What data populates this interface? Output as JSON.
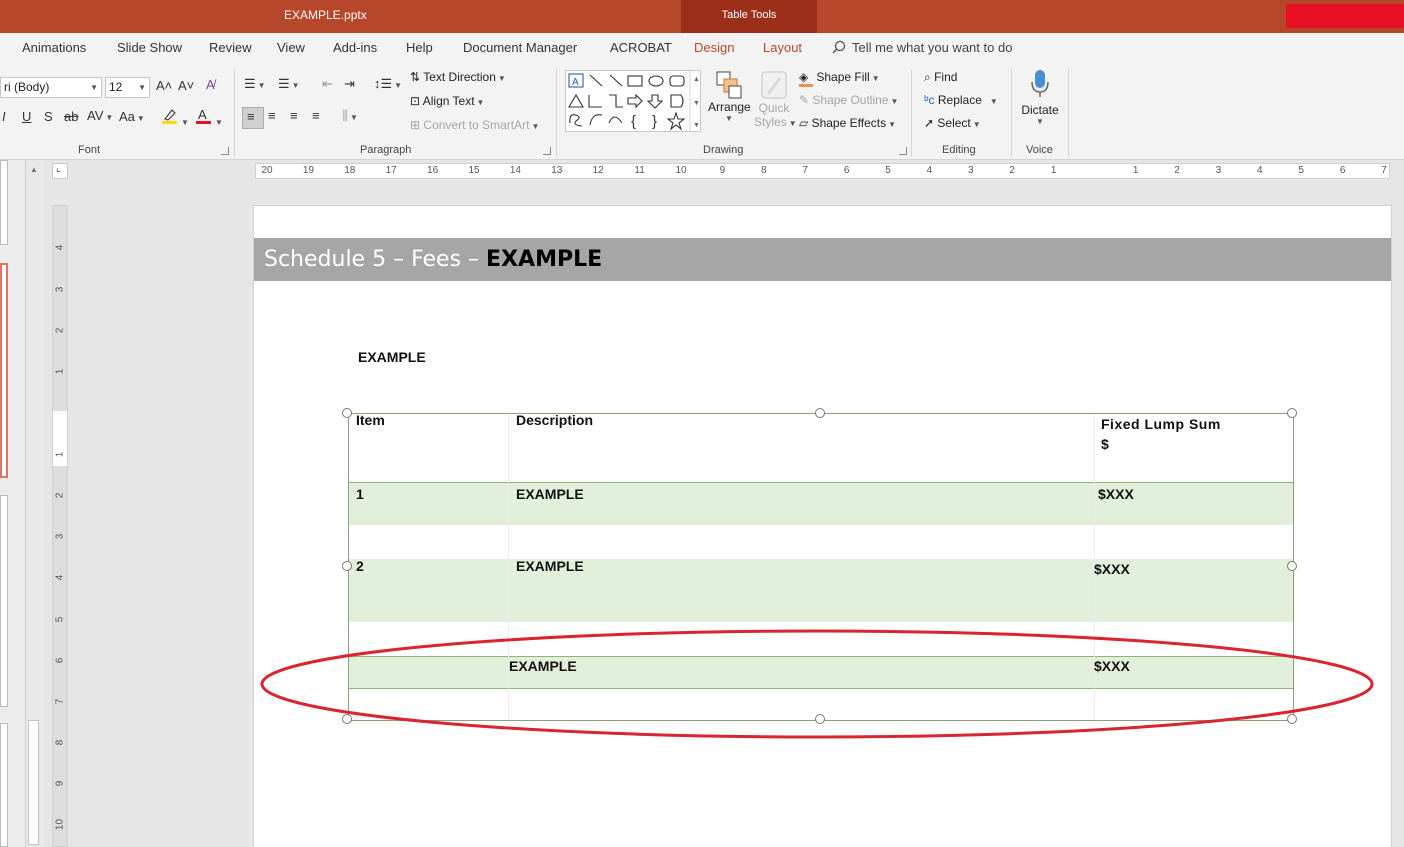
{
  "title_bar": {
    "document_title": "EXAMPLE.pptx",
    "context_tab": "Table Tools"
  },
  "tabs": [
    {
      "label": "Animations"
    },
    {
      "label": "Slide Show"
    },
    {
      "label": "Review"
    },
    {
      "label": "View"
    },
    {
      "label": "Add-ins"
    },
    {
      "label": "Help"
    },
    {
      "label": "Document Manager"
    },
    {
      "label": "ACROBAT"
    },
    {
      "label": "Design"
    },
    {
      "label": "Layout"
    }
  ],
  "tell_me": "Tell me what you want to do",
  "ribbon": {
    "font": {
      "name": "ri (Body)",
      "size": "12",
      "group_label": "Font"
    },
    "paragraph": {
      "text_direction": "Text Direction",
      "align_text": "Align Text",
      "convert_smartart": "Convert to SmartArt",
      "group_label": "Paragraph"
    },
    "drawing": {
      "arrange": "Arrange",
      "quick_styles_1": "Quick",
      "quick_styles_2": "Styles",
      "shape_fill": "Shape Fill",
      "shape_outline": "Shape Outline",
      "shape_effects": "Shape Effects",
      "group_label": "Drawing"
    },
    "editing": {
      "find": "Find",
      "replace": "Replace",
      "select": "Select",
      "group_label": "Editing"
    },
    "voice": {
      "dictate": "Dictate",
      "group_label": "Voice"
    }
  },
  "ruler_labels": [
    "20",
    "19",
    "18",
    "17",
    "16",
    "15",
    "14",
    "13",
    "12",
    "11",
    "10",
    "9",
    "8",
    "7",
    "6",
    "5",
    "4",
    "3",
    "2",
    "1",
    "1",
    "2",
    "3",
    "4",
    "5",
    "6",
    "7"
  ],
  "vruler_labels": [
    "4",
    "3",
    "2",
    "1",
    "1",
    "2",
    "3",
    "4",
    "5",
    "6",
    "7",
    "8",
    "9",
    "10"
  ],
  "slide": {
    "header_prefix": "Schedule 5 – Fees – ",
    "header_bold": "EXAMPLE",
    "label": "EXAMPLE",
    "table": {
      "headers": {
        "item": "Item",
        "description": "Description",
        "fixed_line1": "Fixed  Lump  Sum",
        "fixed_line2": "$"
      },
      "rows": [
        {
          "item": "1",
          "description": "EXAMPLE",
          "amount": "$XXX"
        },
        {
          "item": "2",
          "description": "EXAMPLE",
          "amount": "$XXX"
        },
        {
          "item": "",
          "description": "EXAMPLE",
          "amount": "$XXX"
        }
      ]
    }
  },
  "colors": {
    "title_bar": "#b7472a",
    "header_band": "#a6a6a6",
    "row_shade": "#e2efda",
    "annotation": "#d9252f"
  }
}
